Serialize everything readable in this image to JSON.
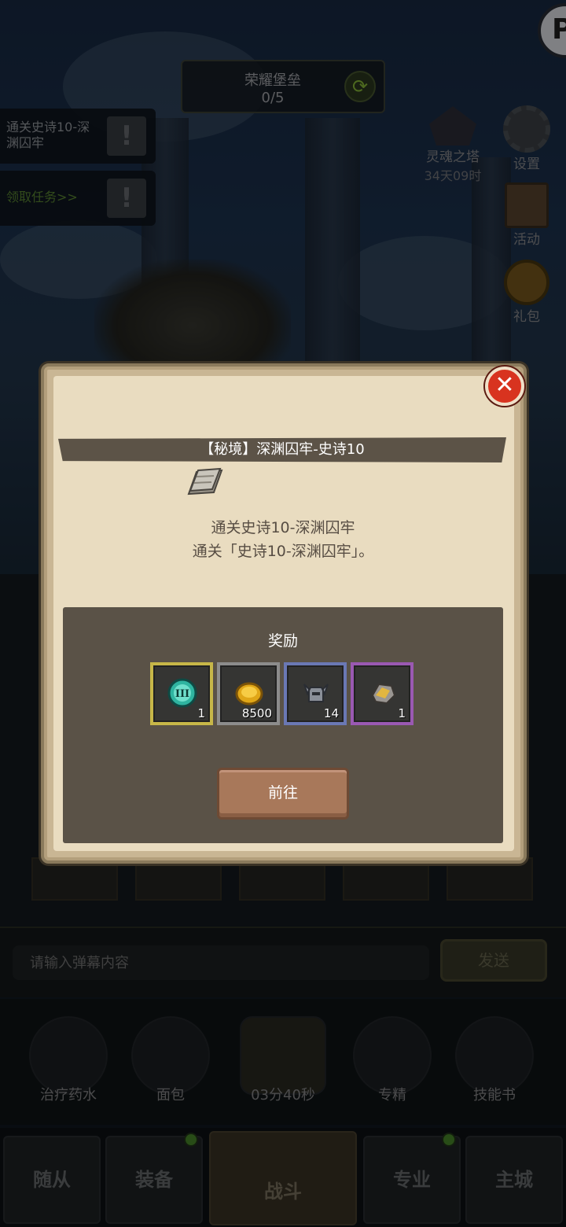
{
  "hud": {
    "fortress": {
      "title": "荣耀堡垒",
      "progress": "0/5"
    },
    "quests": [
      {
        "text": "通关史诗10-深渊囚牢"
      },
      {
        "text": "领取任务>>"
      }
    ],
    "side": {
      "soul_tower": {
        "label": "灵魂之塔",
        "timer": "34天09时"
      },
      "settings": "设置",
      "activity": "活动",
      "gift": "礼包"
    }
  },
  "modal": {
    "title": "【秘境】深渊囚牢-史诗10",
    "quest_name": "通关史诗10-深渊囚牢",
    "quest_desc": "通关「史诗10-深渊囚牢」。",
    "reward_title": "奖励",
    "rewards": [
      {
        "icon": "gem-III-icon",
        "qty": "1",
        "rarity_color": "#c7b748"
      },
      {
        "icon": "gold-coin-icon",
        "qty": "8500",
        "rarity_color": "#8c8c8c"
      },
      {
        "icon": "helmet-icon",
        "qty": "14",
        "rarity_color": "#6a78b4"
      },
      {
        "icon": "gauntlet-icon",
        "qty": "1",
        "rarity_color": "#9a59b2"
      }
    ],
    "go_label": "前往",
    "close_icon": "close-icon"
  },
  "chat": {
    "placeholder": "请输入弹幕内容",
    "send_label": "发送"
  },
  "quick": {
    "heal": "治疗药水",
    "bread": "面包",
    "chest_timer": "03分40秒",
    "master": "专精",
    "skill_book": "技能书"
  },
  "nav": {
    "follower": "随从",
    "equipment": "装备",
    "battle": "战斗",
    "profession": "专业",
    "main_city": "主城"
  },
  "colors": {
    "close": "#d8331f",
    "parchment": "#e9dcc0",
    "panel": "#5a5247"
  }
}
